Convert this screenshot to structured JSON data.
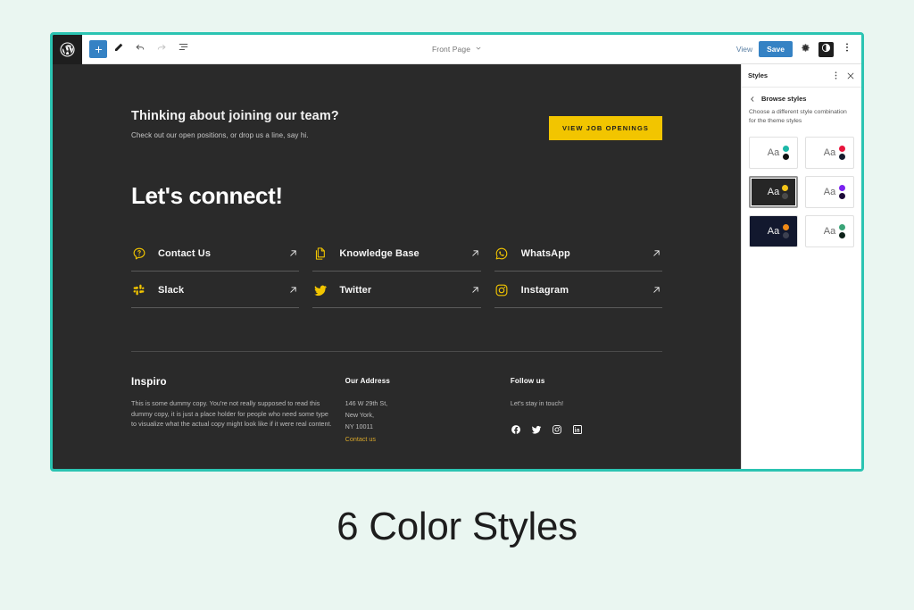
{
  "caption": "6 Color Styles",
  "toolbar": {
    "logo_icon": "wordpress-logo-icon",
    "add_block_label": "+",
    "tools": [
      {
        "name": "add-block-button",
        "icon": "plus-icon"
      },
      {
        "name": "edit-tools-button",
        "icon": "pencil-icon"
      },
      {
        "name": "undo-button",
        "icon": "undo-arrow-icon"
      },
      {
        "name": "redo-button",
        "icon": "redo-arrow-icon"
      },
      {
        "name": "list-view-button",
        "icon": "document-outline-icon"
      }
    ],
    "document_title": "Front Page",
    "document_title_chevron": "chevron-down-icon",
    "view_label": "View",
    "save_label": "Save",
    "settings_icon": "gear-icon",
    "styles_icon": "contrast-half-circle-icon",
    "options_icon": "vertical-ellipsis-icon"
  },
  "sidebar": {
    "title": "Styles",
    "more_icon": "vertical-ellipsis-icon",
    "close_icon": "close-x-icon",
    "back_icon": "chevron-left-icon",
    "nav_label": "Browse styles",
    "description": "Choose a different style combination for the theme styles",
    "swatches": [
      {
        "label": "Aa",
        "bg": "#ffffff",
        "text": "#6b6b6b",
        "dot_top": "#1cb8a8",
        "dot_bottom": "#101010",
        "selected": false,
        "name": "style-variation-teal"
      },
      {
        "label": "Aa",
        "bg": "#ffffff",
        "text": "#6b6b6b",
        "dot_top": "#e8143c",
        "dot_bottom": "#141c2e",
        "selected": false,
        "name": "style-variation-crimson"
      },
      {
        "label": "Aa",
        "bg": "#262626",
        "text": "#f0f0f0",
        "dot_top": "#f5c518",
        "dot_bottom": "#4a4a4a",
        "selected": true,
        "name": "style-variation-yellow-dark"
      },
      {
        "label": "Aa",
        "bg": "#ffffff",
        "text": "#6b6b6b",
        "dot_top": "#7a22f0",
        "dot_bottom": "#1c0a38",
        "selected": false,
        "name": "style-variation-violet"
      },
      {
        "label": "Aa",
        "bg": "#12182e",
        "text": "#f0f0f0",
        "dot_top": "#f08a16",
        "dot_bottom": "#3c4050",
        "selected": false,
        "name": "style-variation-orange-navy"
      },
      {
        "label": "Aa",
        "bg": "#ffffff",
        "text": "#6b6b6b",
        "dot_top": "#3aa477",
        "dot_bottom": "#0c2118",
        "selected": false,
        "name": "style-variation-green"
      }
    ]
  },
  "page": {
    "cta": {
      "heading": "Thinking about joining our team?",
      "subheading": "Check out our open positions, or drop us a line, say hi.",
      "button_label": "VIEW JOB OPENINGS"
    },
    "connect_heading": "Let's connect!",
    "links": [
      {
        "label": "Contact Us",
        "icon": "question-speech-bubble-icon",
        "arrow": "arrow-up-right-icon"
      },
      {
        "label": "Knowledge Base",
        "icon": "copy-pages-icon",
        "arrow": "arrow-up-right-icon"
      },
      {
        "label": "WhatsApp",
        "icon": "whatsapp-icon",
        "arrow": "arrow-up-right-icon"
      },
      {
        "label": "Slack",
        "icon": "slack-icon",
        "arrow": "arrow-up-right-icon"
      },
      {
        "label": "Twitter",
        "icon": "twitter-bird-icon",
        "arrow": "arrow-up-right-icon"
      },
      {
        "label": "Instagram",
        "icon": "instagram-icon",
        "arrow": "arrow-up-right-icon"
      }
    ],
    "footer": {
      "brand": "Inspiro",
      "brand_body": "This is some dummy copy. You're not really supposed to read this dummy copy, it is just a place holder for people who need some type to visualize what the actual copy might look like if it were real content.",
      "address_heading": "Our Address",
      "address_lines": "146 W 29th St,\nNew York,\nNY 10011",
      "address_link": "Contact us",
      "follow_heading": "Follow us",
      "follow_note": "Let's stay in touch!",
      "social_icons": [
        "facebook-icon",
        "twitter-bird-icon",
        "instagram-icon",
        "linkedin-icon"
      ]
    }
  },
  "colors": {
    "accent_yellow": "#f2c500",
    "canvas_dark": "#2a2a2a",
    "frame_border": "#2bc4b2",
    "wp_blue": "#3582c4",
    "page_bg": "#eaf6f1"
  }
}
